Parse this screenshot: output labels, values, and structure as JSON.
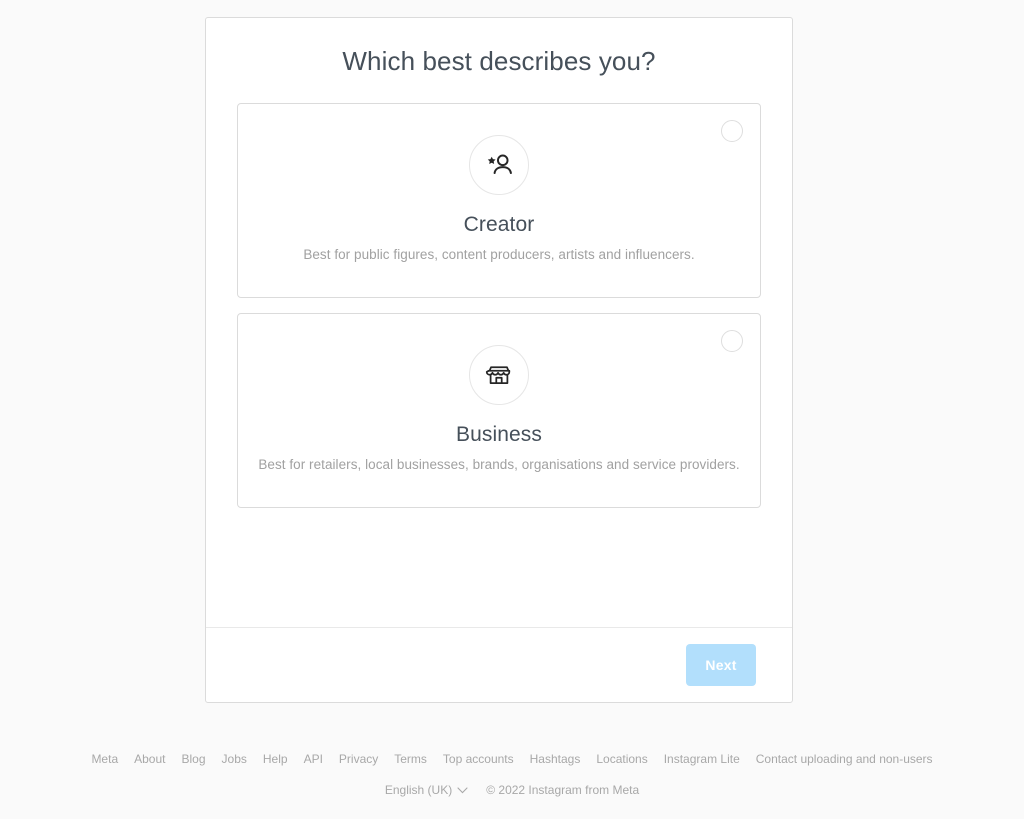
{
  "page": {
    "background_color": "#fafafa"
  },
  "panel": {
    "title": "Which best describes you?",
    "options": [
      {
        "id": "creator",
        "icon": "creator-star-person-icon",
        "label": "Creator",
        "description": "Best for public figures, content producers, artists and influencers.",
        "selected": false,
        "radio_name": "creator-radio"
      },
      {
        "id": "business",
        "icon": "storefront-icon",
        "label": "Business",
        "description": "Best for retailers, local businesses, brands, organisations and service providers.",
        "selected": false,
        "radio_name": "business-radio"
      }
    ],
    "footer": {
      "next_label": "Next",
      "next_enabled": false,
      "next_color": "#b2dffc"
    }
  },
  "site_footer": {
    "links": [
      "Meta",
      "About",
      "Blog",
      "Jobs",
      "Help",
      "API",
      "Privacy",
      "Terms",
      "Top accounts",
      "Hashtags",
      "Locations",
      "Instagram Lite",
      "Contact uploading and non-users"
    ],
    "language": "English (UK)",
    "language_chevron": "chevron-down-icon",
    "copyright": "© 2022 Instagram from Meta"
  }
}
